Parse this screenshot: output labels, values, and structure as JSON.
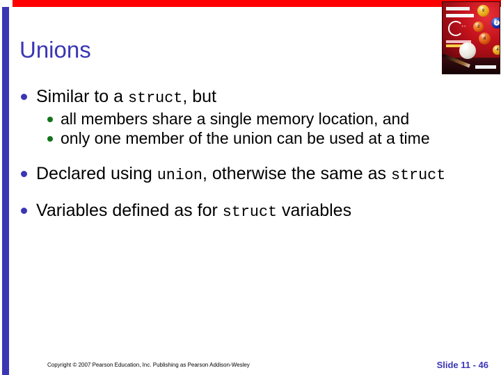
{
  "slide": {
    "title": "Unions",
    "accent_blue": "#3A36B4",
    "accent_red": "#FF0000",
    "bullet_level2_green": "#14731A",
    "background": "#FFFFFF"
  },
  "decor": {
    "top_bar_name": "red-top-bar",
    "left_bar_name": "blue-left-bar"
  },
  "book_cover": {
    "title": "Starting Out with C++",
    "subtitle": "From Control Structures through Objects",
    "edition": "Fifth Edition",
    "author": "Tony Gaddis",
    "ball_9": "9",
    "ball_2": "2",
    "ball_3": "3",
    "ball_8": "8",
    "ball_4": "4"
  },
  "content": {
    "bullets": [
      {
        "level": 1,
        "parts": [
          {
            "text": "Similar to a ",
            "mono": false
          },
          {
            "text": "struct",
            "mono": true
          },
          {
            "text": ", but",
            "mono": false
          }
        ]
      },
      {
        "level": 2,
        "parts": [
          {
            "text": "all members share a single memory location, and",
            "mono": false
          }
        ]
      },
      {
        "level": 2,
        "parts": [
          {
            "text": "only one member of the union can be used at a time",
            "mono": false
          }
        ]
      },
      {
        "level": 1,
        "parts": [
          {
            "text": "Declared using ",
            "mono": false
          },
          {
            "text": "union",
            "mono": true
          },
          {
            "text": ", otherwise the same as ",
            "mono": false
          },
          {
            "text": "struct",
            "mono": true
          }
        ]
      },
      {
        "level": 1,
        "parts": [
          {
            "text": "Variables defined as for ",
            "mono": false
          },
          {
            "text": "struct",
            "mono": true
          },
          {
            "text": " variables",
            "mono": false
          }
        ]
      }
    ],
    "b1_text_a": "Similar to a ",
    "b1_mono": "struct",
    "b1_text_b": ", but",
    "b2_text": "all members share a single memory location, and",
    "b3_text": "only one member of the union can be used at a time",
    "b4_text_a": "Declared using ",
    "b4_mono_a": "union",
    "b4_text_b": ", otherwise the same as ",
    "b4_mono_b": "struct",
    "b5_text_a": "Variables defined as for ",
    "b5_mono": "struct",
    "b5_text_b": " variables"
  },
  "footer": {
    "copyright": "Copyright © 2007 Pearson Education, Inc. Publishing as Pearson Addison-Wesley",
    "slide_number": "Slide 11 - 46"
  }
}
